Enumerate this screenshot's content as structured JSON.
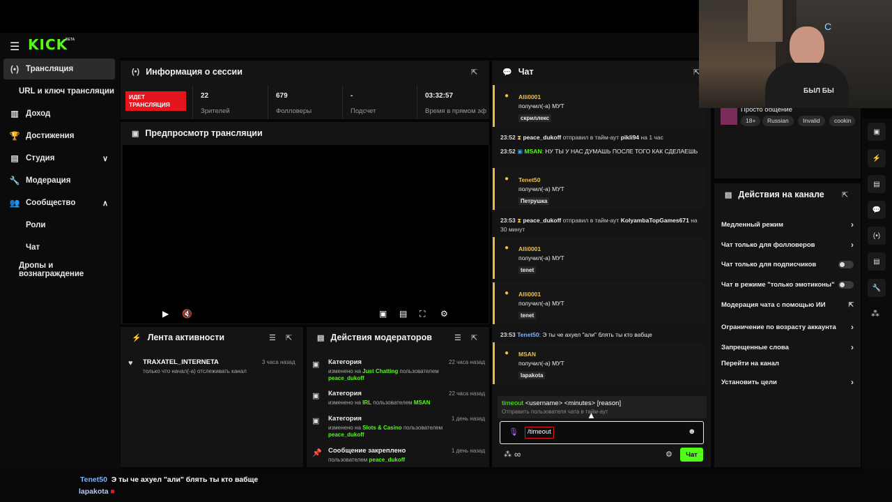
{
  "brand": {
    "logo": "KICK",
    "beta": "BETA"
  },
  "sidebar": {
    "items": [
      {
        "label": "Трансляция",
        "icon": "broadcast-icon"
      },
      {
        "label": "URL и ключ трансляции"
      },
      {
        "label": "Доход",
        "icon": "chart-icon"
      },
      {
        "label": "Достижения",
        "icon": "trophy-icon"
      },
      {
        "label": "Студия",
        "icon": "studio-icon"
      },
      {
        "label": "Модерация",
        "icon": "wrench-icon"
      },
      {
        "label": "Сообщество",
        "icon": "community-icon"
      },
      {
        "label": "Роли"
      },
      {
        "label": "Чат"
      },
      {
        "label": "Дропы и вознаграждение"
      }
    ]
  },
  "session": {
    "title": "Информация о сессии",
    "live_badge": "ИДЕТ ТРАНСЛЯЦИЯ",
    "stats": [
      {
        "value": "22",
        "label": "Зрителей"
      },
      {
        "value": "679",
        "label": "Фолловеры"
      },
      {
        "value": "-",
        "label": "Подсчет подписок"
      },
      {
        "value": "03:32:57",
        "label": "Время в прямом эфире"
      }
    ]
  },
  "preview": {
    "title": "Предпросмотр трансляции"
  },
  "activity": {
    "title": "Лента активности",
    "items": [
      {
        "user": "TRAXATEL_INTERNETA",
        "text": "только что начал(-а) отслеживать канал",
        "when": "3 часа назад"
      }
    ]
  },
  "modactions": {
    "title": "Действия модераторов",
    "items": [
      {
        "title": "Категория",
        "when": "22 часа назад",
        "pre": "изменено на",
        "value": "Just Chatting",
        "mid": "пользователем",
        "user": "peace_dukoff"
      },
      {
        "title": "Категория",
        "when": "22 часа назад",
        "pre": "изменено на",
        "value": "IRL",
        "mid": "пользователем",
        "user": "MSAN"
      },
      {
        "title": "Категория",
        "when": "1 день назад",
        "pre": "изменено на",
        "value": "Slots & Casino",
        "mid": "пользователем",
        "user": "peace_dukoff"
      },
      {
        "title": "Сообщение закреплено",
        "when": "1 день назад",
        "pre": "пользователем",
        "value": "peace_dukoff",
        "mid": "",
        "user": ""
      }
    ]
  },
  "chat": {
    "title": "Чат",
    "m1": {
      "user": "Alli0001",
      "text": "получил(-а) МУТ",
      "tag": "скриллекс"
    },
    "s1": {
      "time": "23:52",
      "user": "peace_dukoff",
      "text": "отправил в тайм-аут",
      "target": "pikli94",
      "suffix": "на 1 час"
    },
    "s2": {
      "time": "23:52",
      "user": "MSAN",
      "text": "НУ ТЫ У НАС ДУМАШЬ ПОСЛЕ ТОГО КАК СДЕЛАЕШЬ"
    },
    "m2": {
      "user": "Tenet50",
      "text": "получил(-а) МУТ",
      "tag": "Петрушка"
    },
    "s3": {
      "time": "23:53",
      "user": "peace_dukoff",
      "text": "отправил в тайм-аут",
      "target": "KolyambaTopGames671",
      "suffix": "на 30 минут"
    },
    "m3": {
      "user": "Alli0001",
      "text": "получил(-а) МУТ",
      "tag": "tenet"
    },
    "m4": {
      "user": "Alli0001",
      "text": "получил(-а) МУТ",
      "tag": "tenet"
    },
    "s4": {
      "time": "23:53",
      "user": "Tenet50",
      "text": "Э ты че ахуел \"али\" блять ты кто вабще"
    },
    "m5": {
      "user": "MSAN",
      "text": "получил(-а) МУТ",
      "tag": "lapakota"
    },
    "cmd": {
      "name": "timeout",
      "args": "<username> <minutes> [reason]",
      "desc": "Отправить пользователя чата в тайм-аут"
    },
    "input": "/timeout",
    "send": "Чат"
  },
  "stream_info": {
    "title": "Просто общение",
    "tags": [
      "18+",
      "Russian",
      "Invalid",
      "cookin"
    ]
  },
  "channel_actions": {
    "title": "Действия на канале",
    "items": [
      {
        "label": "Медленный режим",
        "ctl": "chev"
      },
      {
        "label": "Чат только для фолловеров",
        "ctl": "chev"
      },
      {
        "label": "Чат только для подписчиков",
        "ctl": "toggle"
      },
      {
        "label": "Чат в режиме \"только эмотиконы\"",
        "ctl": "toggle"
      },
      {
        "label": "Модерация чата с помощью ИИ",
        "ctl": "ext"
      },
      {
        "label": "Ограничение по возрасту аккаунта",
        "ctl": "chev"
      },
      {
        "label": "Запрещенные слова",
        "ctl": "chev"
      },
      {
        "label": "Перейти на канал",
        "ctl": "none"
      },
      {
        "label": "Установить цели",
        "ctl": "chev"
      }
    ]
  },
  "overlay": {
    "line1_user": "Tenet50",
    "line1_text": "Э ты че ахуел \"али\" блять ты кто вабще",
    "line2_user": "lapakota"
  },
  "webcam": {
    "shirt_text": "БЫЛ БЫ"
  },
  "colors": {
    "accent": "#53fc18",
    "live": "#e5151d",
    "mute_border": "#e6b84a"
  }
}
